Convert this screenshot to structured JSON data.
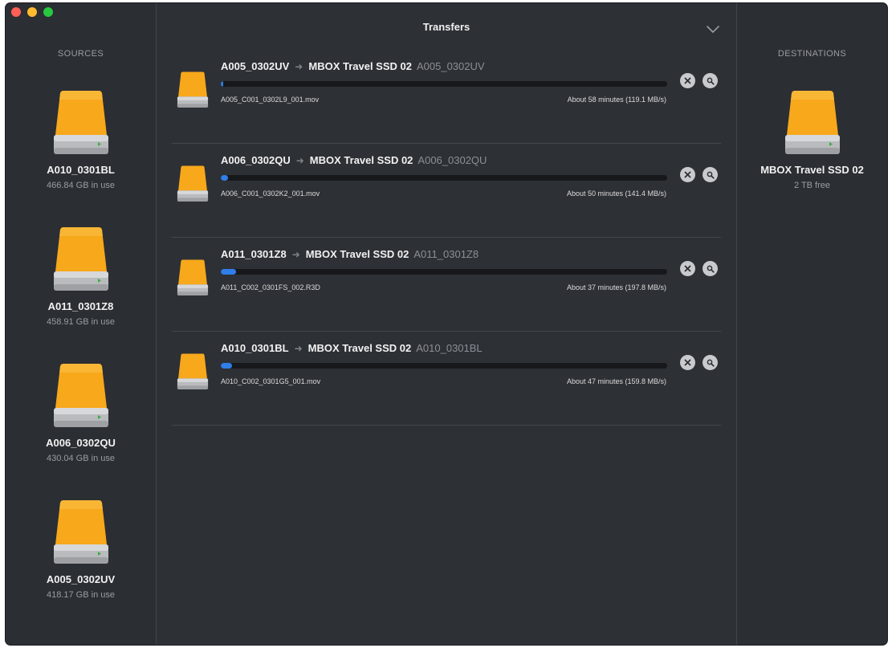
{
  "window": {
    "title": "Transfers",
    "traffic_lights": [
      "close",
      "minimize",
      "zoom"
    ]
  },
  "sources": {
    "title": "SOURCES",
    "drives": [
      {
        "name": "A010_0301BL",
        "usage": "466.84 GB in use",
        "icon": "hard-drive-icon"
      },
      {
        "name": "A011_0301Z8",
        "usage": "458.91 GB in use",
        "icon": "hard-drive-icon"
      },
      {
        "name": "A006_0302QU",
        "usage": "430.04 GB in use",
        "icon": "hard-drive-icon"
      },
      {
        "name": "A005_0302UV",
        "usage": "418.17 GB in use",
        "icon": "hard-drive-icon"
      }
    ]
  },
  "destinations": {
    "title": "DESTINATIONS",
    "drives": [
      {
        "name": "MBOX Travel SSD 02",
        "usage": "2 TB free",
        "icon": "hard-drive-icon"
      }
    ]
  },
  "transfers": [
    {
      "source": "A005_0302UV",
      "destination": "MBOX Travel SSD 02",
      "folder": "A005_0302UV",
      "file": "A005_C001_0302L9_001.mov",
      "eta": "About 58 minutes (119.1 MB/s)",
      "progress": 0.005
    },
    {
      "source": "A006_0302QU",
      "destination": "MBOX Travel SSD 02",
      "folder": "A006_0302QU",
      "file": "A006_C001_0302K2_001.mov",
      "eta": "About 50 minutes (141.4 MB/s)",
      "progress": 0.017
    },
    {
      "source": "A011_0301Z8",
      "destination": "MBOX Travel SSD 02",
      "folder": "A011_0301Z8",
      "file": "A011_C002_0301FS_002.R3D",
      "eta": "About 37 minutes (197.8 MB/s)",
      "progress": 0.034
    },
    {
      "source": "A010_0301BL",
      "destination": "MBOX Travel SSD 02",
      "folder": "A010_0301BL",
      "file": "A010_C002_0301G5_001.mov",
      "eta": "About 47 minutes (159.8 MB/s)",
      "progress": 0.025
    }
  ],
  "colors": {
    "background": "#2d3035",
    "sidebar": "#2b2e33",
    "progress_fill": "#2f7ee9",
    "progress_track": "#17181b",
    "drive_orange": "#f7a81b"
  }
}
